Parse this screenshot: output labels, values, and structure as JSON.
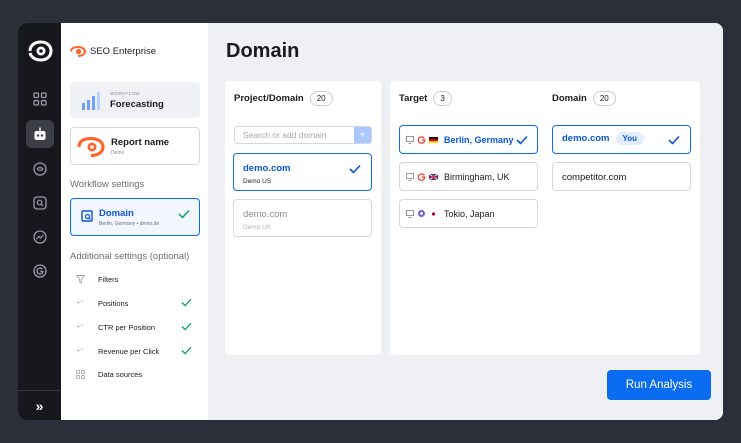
{
  "brand": {
    "name": "SEO Enterprise"
  },
  "sidebar": {
    "workflow_kicker": "WORKFLOW",
    "workflow_title": "Forecasting",
    "report_name": "Report name",
    "report_sub": "Demo",
    "workflow_settings_title": "Workflow settings",
    "domain_card": {
      "title": "Domain",
      "sub": "Berlin, Germany • demo.de"
    },
    "additional_title": "Additional settings (optional)",
    "settings": [
      {
        "label": "Filters",
        "checked": false
      },
      {
        "label": "Positions",
        "checked": true
      },
      {
        "label": "CTR per Position",
        "checked": true
      },
      {
        "label": "Revenue per Click",
        "checked": true
      },
      {
        "label": "Data sources",
        "checked": false
      }
    ],
    "expand_label": "»"
  },
  "main": {
    "title": "Domain",
    "project_panel": {
      "header": "Project/Domain",
      "count": "20",
      "search_placeholder": "Search or add domain",
      "add_label": "+",
      "items": [
        {
          "title": "demo.com",
          "sub": "Demo US",
          "selected": true
        },
        {
          "title": "demo.com",
          "sub": "Demo UK",
          "selected": false
        }
      ]
    },
    "target_panel": {
      "header": "Target",
      "count": "3",
      "items": [
        {
          "label": "Berlin, Germany",
          "selected": true
        },
        {
          "label": "Birmingham, UK",
          "selected": false
        },
        {
          "label": "Tokio, Japan",
          "selected": false
        }
      ]
    },
    "domain_panel": {
      "header": "Domain",
      "count": "20",
      "items": [
        {
          "label": "demo.com",
          "badge": "You",
          "selected": true
        },
        {
          "label": "competitor.com",
          "selected": false
        }
      ]
    },
    "run_button": "Run Analysis"
  },
  "colors": {
    "accent": "#0a6cf0",
    "brand_orange": "#ff642d",
    "success": "#1ea672",
    "rail_bg": "#17181d"
  }
}
